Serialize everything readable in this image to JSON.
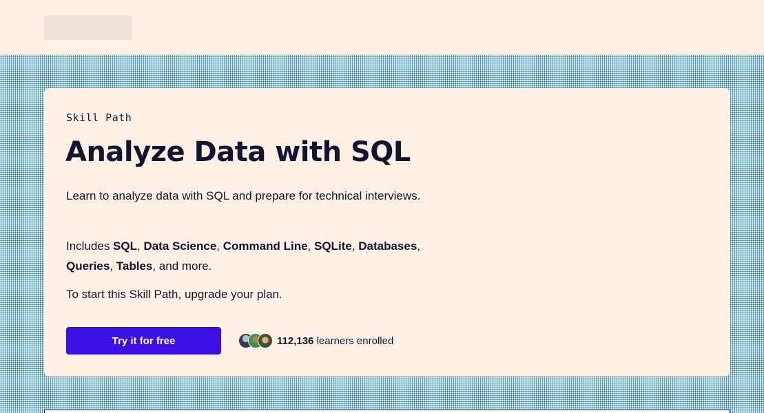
{
  "hero": {
    "eyebrow": "Skill Path",
    "title": "Analyze Data with SQL",
    "description": "Learn to analyze data with SQL and prepare for technical interviews.",
    "includes_prefix": "Includes ",
    "includes_items": [
      "SQL",
      "Data Science",
      "Command Line",
      "SQLite",
      "Databases",
      "Queries",
      "Tables"
    ],
    "includes_suffix": ", and more.",
    "upgrade_text": "To start this Skill Path, upgrade your plan.",
    "cta_label": "Try it for free",
    "enrolled_count": "112,136",
    "enrolled_label": " learners enrolled"
  },
  "colors": {
    "background_pattern": "#1f6f9a",
    "card_background": "#fff0e5",
    "cta": "#3a10e5",
    "text": "#10162f"
  }
}
